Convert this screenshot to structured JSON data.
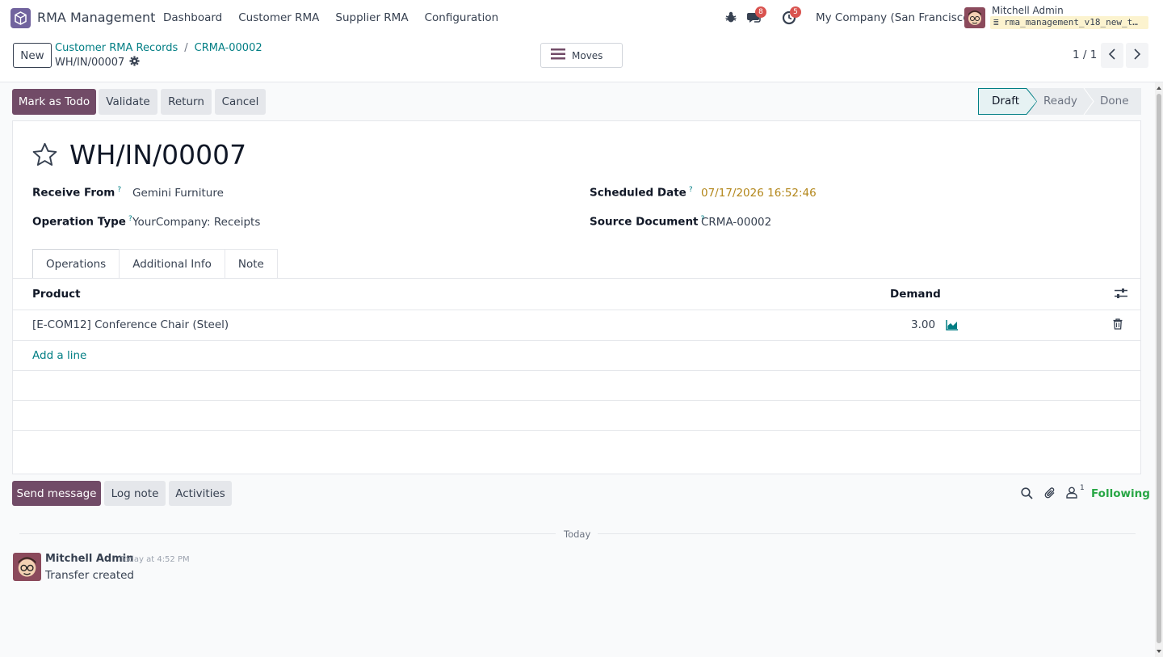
{
  "app": {
    "name": "RMA Management",
    "accent": "#714b67",
    "link_color": "#017e84"
  },
  "menu": [
    "Dashboard",
    "Customer RMA",
    "Supplier RMA",
    "Configuration"
  ],
  "systray": {
    "messages_count": "8",
    "activities_count": "5",
    "company": "My Company (San Francisco)",
    "user_name": "Mitchell Admin",
    "database": "rma_management_v18_new_t…"
  },
  "control": {
    "new_label": "New",
    "breadcrumb": [
      "Customer RMA Records",
      "CRMA-00002"
    ],
    "current": "WH/IN/00007",
    "moves_label": "Moves",
    "pager": "1 / 1"
  },
  "actions": [
    "Mark as Todo",
    "Validate",
    "Return",
    "Cancel"
  ],
  "status": {
    "stages": [
      "Draft",
      "Ready",
      "Done"
    ],
    "active": "Draft"
  },
  "record": {
    "title": "WH/IN/00007",
    "receive_from_label": "Receive From",
    "receive_from": "Gemini Furniture",
    "operation_type_label": "Operation Type",
    "operation_type": "YourCompany: Receipts",
    "scheduled_date_label": "Scheduled Date",
    "scheduled_date": "07/17/2026 16:52:46",
    "source_document_label": "Source Document",
    "source_document": "CRMA-00002",
    "help_mark": "?"
  },
  "tabs": [
    "Operations",
    "Additional Info",
    "Note"
  ],
  "operations": {
    "col_product": "Product",
    "col_demand": "Demand",
    "rows": [
      {
        "product": "[E-COM12] Conference Chair (Steel)",
        "demand": "3.00"
      }
    ],
    "add_line": "Add a line"
  },
  "chatter": {
    "send_message": "Send message",
    "log_note": "Log note",
    "activities": "Activities",
    "followers_count": "1",
    "following": "Following",
    "date_separator": "Today",
    "message": {
      "author": "Mitchell Admin",
      "time": "Today at 4:52 PM",
      "body": "Transfer created"
    }
  }
}
